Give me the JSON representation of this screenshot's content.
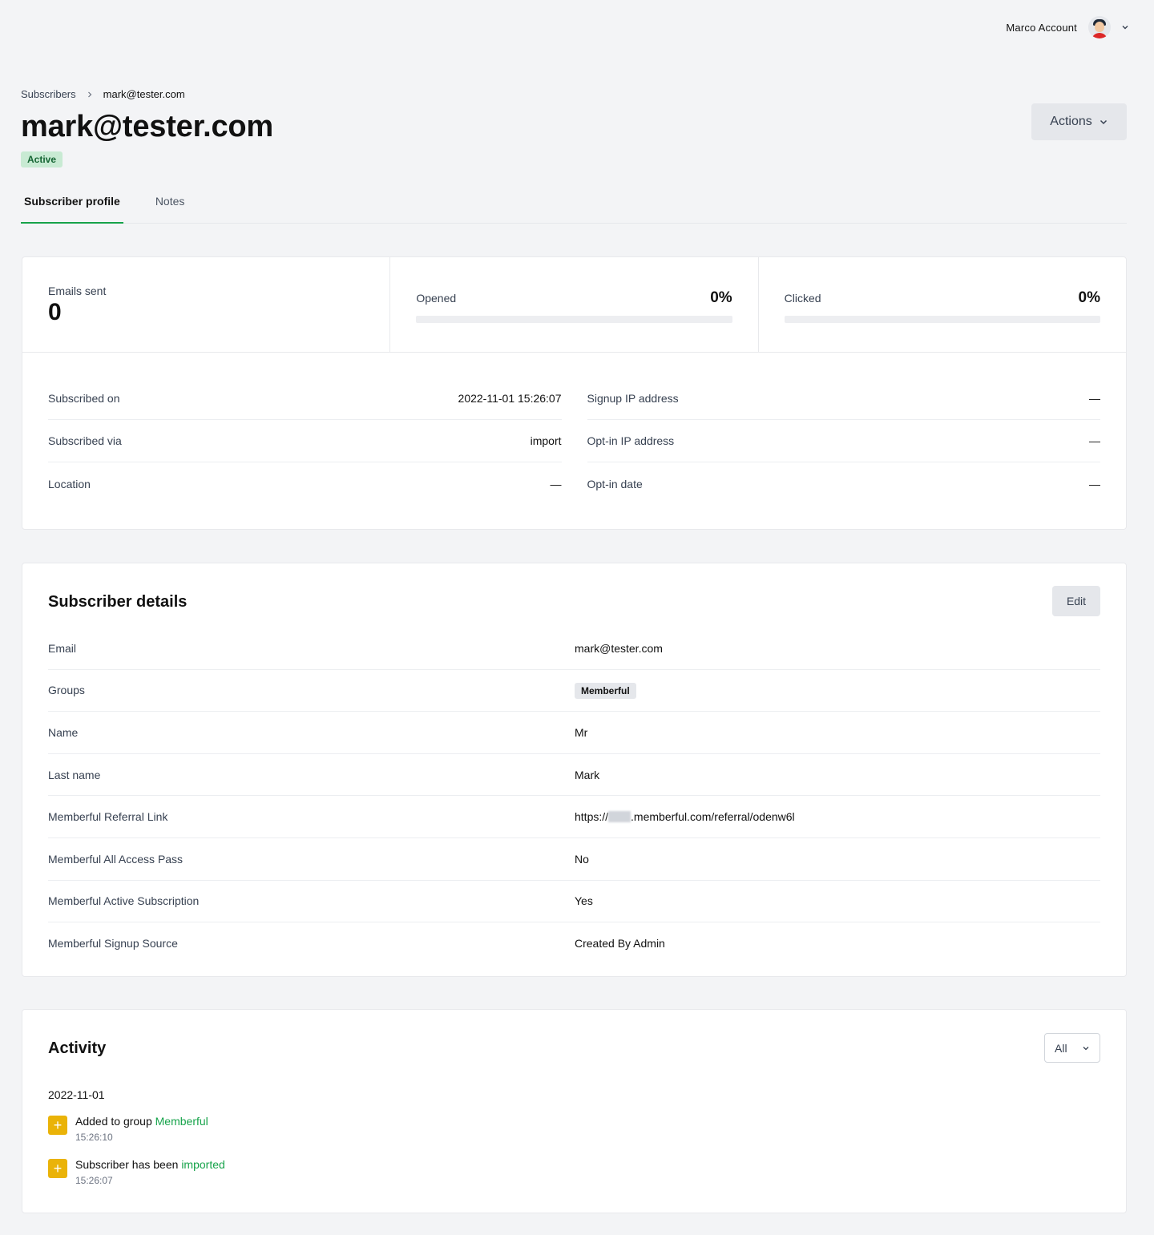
{
  "account": {
    "name": "Marco Account",
    "avatar_icon": "avatar-illustration"
  },
  "breadcrumb": {
    "parent": "Subscribers",
    "current": "mark@tester.com"
  },
  "page": {
    "title": "mark@tester.com",
    "status": "Active",
    "actions_label": "Actions"
  },
  "tabs": [
    {
      "label": "Subscriber profile",
      "active": true
    },
    {
      "label": "Notes",
      "active": false
    }
  ],
  "stats": {
    "emails_sent": {
      "label": "Emails sent",
      "value": "0"
    },
    "opened": {
      "label": "Opened",
      "value": "0%",
      "fraction": 0
    },
    "clicked": {
      "label": "Clicked",
      "value": "0%",
      "fraction": 0
    }
  },
  "info_left": [
    {
      "label": "Subscribed on",
      "value": "2022-11-01 15:26:07"
    },
    {
      "label": "Subscribed via",
      "value": "import"
    },
    {
      "label": "Location",
      "value": "—"
    }
  ],
  "info_right": [
    {
      "label": "Signup IP address",
      "value": "—"
    },
    {
      "label": "Opt-in IP address",
      "value": "—"
    },
    {
      "label": "Opt-in date",
      "value": "—"
    }
  ],
  "details": {
    "title": "Subscriber details",
    "edit_label": "Edit",
    "rows": [
      {
        "label": "Email",
        "value": "mark@tester.com"
      },
      {
        "label": "Groups",
        "value": "Memberful"
      },
      {
        "label": "Name",
        "value": "Mr"
      },
      {
        "label": "Last name",
        "value": "Mark"
      },
      {
        "label": "Memberful Referral Link",
        "value_prefix": "https://",
        "value_suffix": ".memberful.com/referral/odenw6l"
      },
      {
        "label": "Memberful All Access Pass",
        "value": "No"
      },
      {
        "label": "Memberful Active Subscription",
        "value": "Yes"
      },
      {
        "label": "Memberful Signup Source",
        "value": "Created By Admin"
      }
    ]
  },
  "activity": {
    "title": "Activity",
    "filter_value": "All",
    "date": "2022-11-01",
    "items": [
      {
        "text": "Added to group ",
        "link": "Memberful",
        "time": "15:26:10"
      },
      {
        "text": "Subscriber has been ",
        "link": "imported",
        "time": "15:26:07"
      }
    ]
  },
  "colors": {
    "accent": "#16a34a",
    "badge_bg": "#c8ead3",
    "activity_icon": "#eab308"
  }
}
